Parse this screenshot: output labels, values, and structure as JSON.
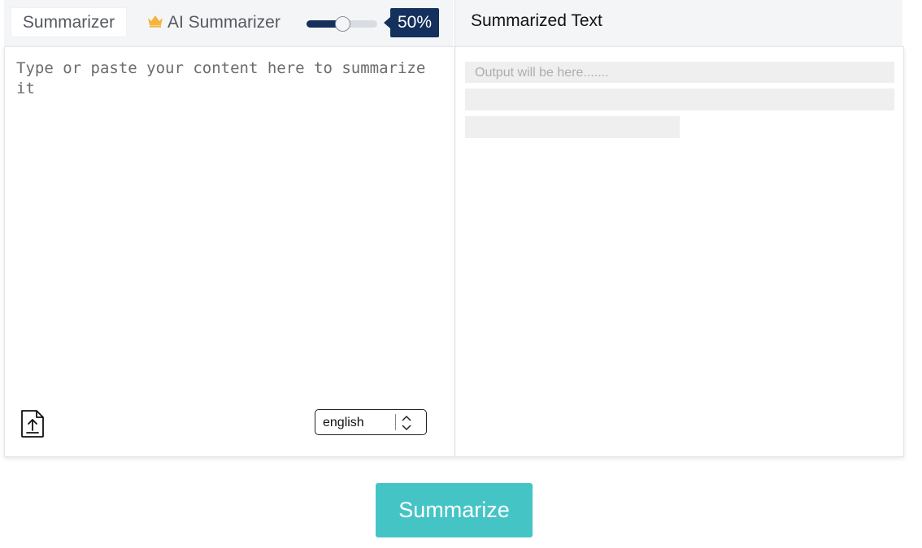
{
  "header": {
    "tab_summarizer": "Summarizer",
    "tab_ai_summarizer": "AI Summarizer",
    "summary_length_percent": 50,
    "summary_length_label": "50%",
    "output_title": "Summarized Text"
  },
  "input": {
    "placeholder": "Type or paste your content here to summarize it",
    "value": ""
  },
  "language": {
    "selected": "english"
  },
  "output": {
    "placeholder": "Output will be here......."
  },
  "actions": {
    "summarize_label": "Summarize"
  },
  "icons": {
    "crown": "crown-icon",
    "upload": "file-upload-icon",
    "select_arrows": "chevron-up-down-icon"
  },
  "colors": {
    "accent_navy": "#14305c",
    "button_teal": "#45c4c6",
    "crown_gold": "#f5b43c"
  }
}
